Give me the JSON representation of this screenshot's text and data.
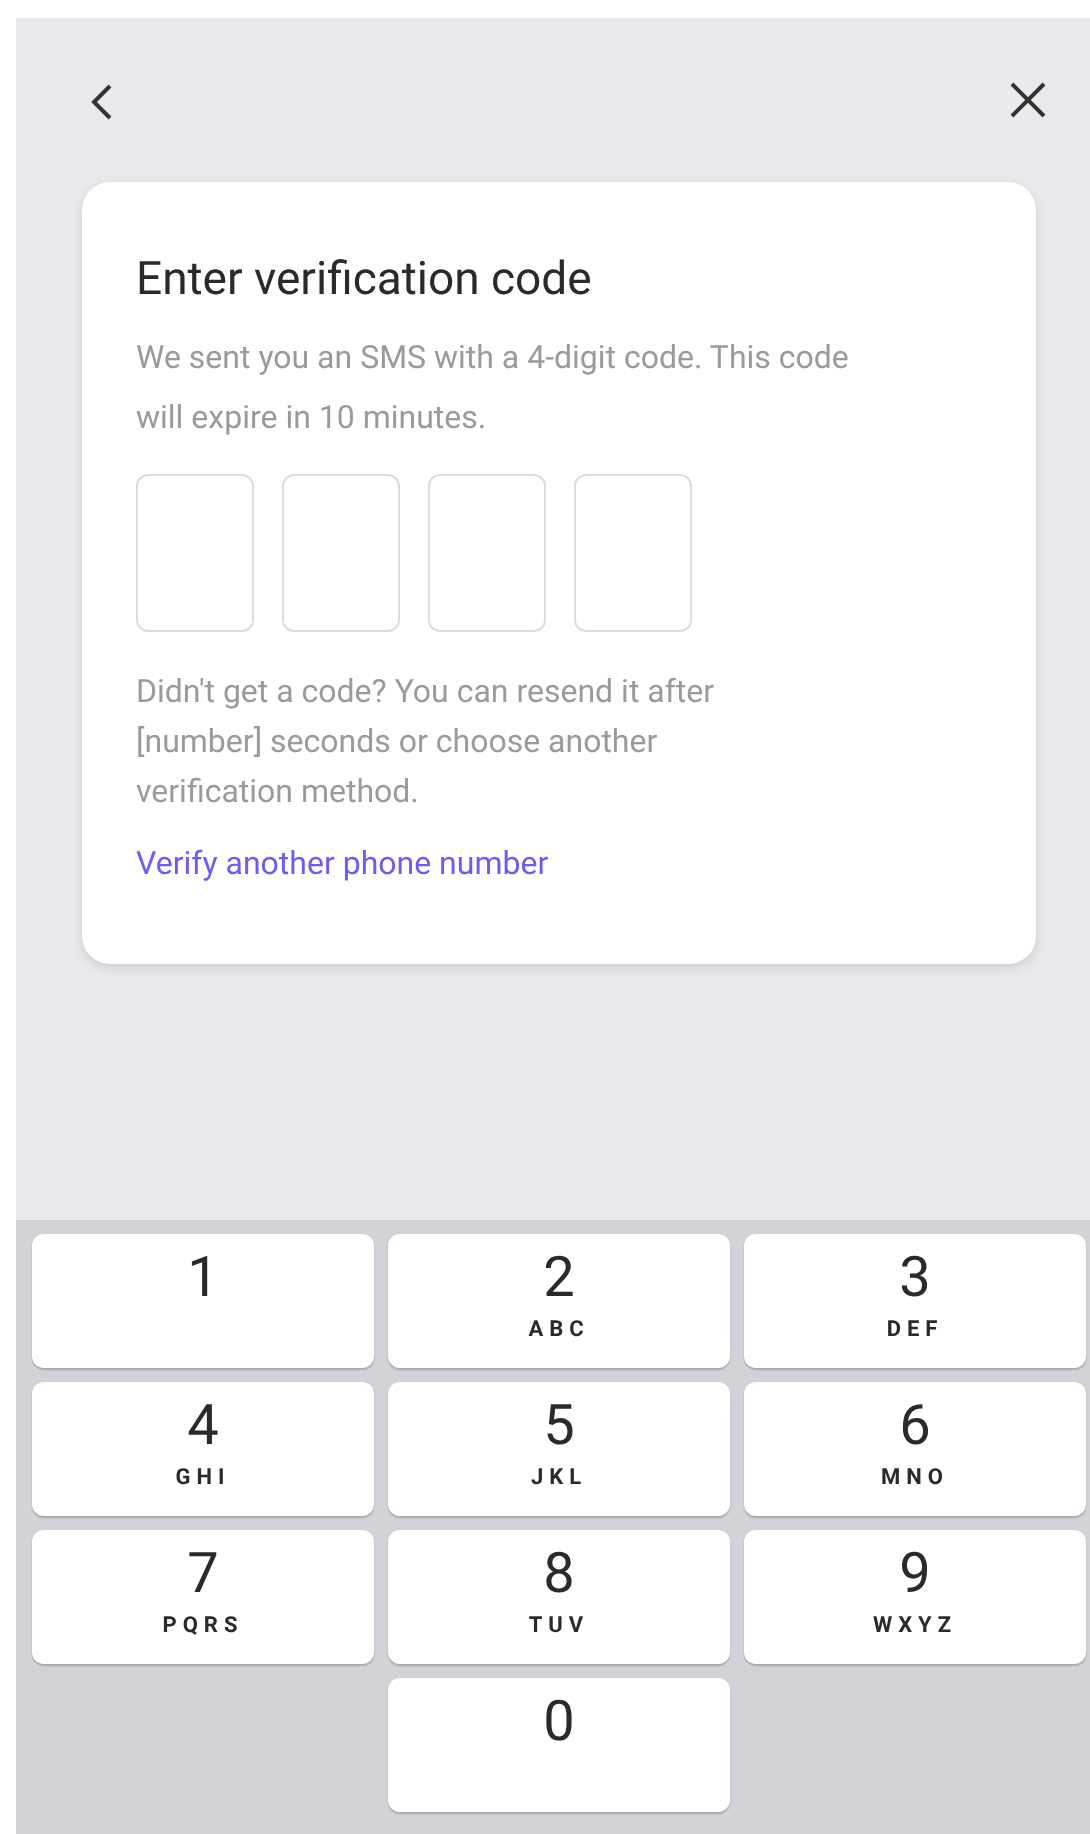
{
  "card": {
    "title": "Enter verification code",
    "description": "We sent you an SMS with a 4-digit code. This code will expire in 10 minutes.",
    "code_fields": [
      {
        "filled": false
      },
      {
        "filled": false
      },
      {
        "filled": false
      },
      {
        "filled": false
      }
    ],
    "resend_note": "Didn't get a code? You can resend it after [number] seconds or choose another verification method.",
    "link": "Verify another phone number"
  },
  "keypad": [
    {
      "digit": "1"
    },
    {
      "digit": "2",
      "letters": "ABC"
    },
    {
      "digit": "3",
      "letters": "DEF"
    },
    {
      "digit": "4",
      "letters": "GHI"
    },
    {
      "digit": "5",
      "letters": "JKL"
    },
    {
      "digit": "6",
      "letters": "MNO"
    },
    {
      "digit": "7",
      "letters": "PQRS"
    },
    {
      "digit": "8",
      "letters": "TUV"
    },
    {
      "digit": "9",
      "letters": "WXYZ"
    },
    {
      "digit": "0"
    }
  ]
}
